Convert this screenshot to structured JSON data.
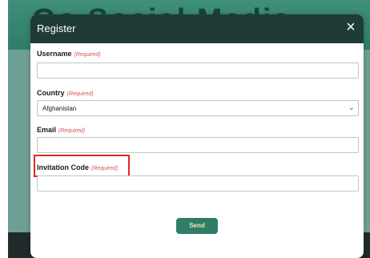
{
  "background": {
    "title": "Go Social Media"
  },
  "modal": {
    "title": "Register",
    "close_symbol": "×",
    "required_text": "(Required)",
    "fields": {
      "username": {
        "label": "Username",
        "value": ""
      },
      "country": {
        "label": "Country",
        "selected": "Afghanistan"
      },
      "email": {
        "label": "Email",
        "value": ""
      },
      "invitation_code": {
        "label": "Invitation Code",
        "value": ""
      }
    },
    "send_label": "Send"
  },
  "colors": {
    "header_bg": "#1f3b38",
    "accent": "#2f7d69",
    "required": "#d9534f",
    "highlight": "#e02424"
  },
  "icons": {
    "close": "close-icon",
    "chevron": "chevron-down-icon"
  }
}
